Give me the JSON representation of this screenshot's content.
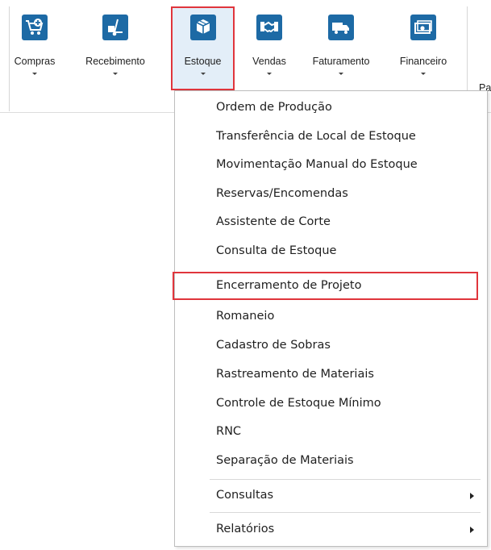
{
  "toolbar": {
    "buttons": [
      {
        "label": "Compras",
        "icon": "cart-plus-icon"
      },
      {
        "label": "Recebimento",
        "icon": "hand-truck-icon"
      },
      {
        "label": "Estoque",
        "icon": "boxes-icon",
        "selected": true
      },
      {
        "label": "Vendas",
        "icon": "handshake-icon"
      },
      {
        "label": "Faturamento",
        "icon": "delivery-truck-icon"
      },
      {
        "label": "Financeiro",
        "icon": "money-icon"
      }
    ],
    "partial_label": "Pa"
  },
  "menu": {
    "items": [
      {
        "label": "Ordem de Produção"
      },
      {
        "label": "Transferência de Local de Estoque"
      },
      {
        "label": "Movimentação Manual do Estoque"
      },
      {
        "label": "Reservas/Encomendas"
      },
      {
        "label": "Assistente de Corte"
      },
      {
        "label": "Consulta de Estoque"
      },
      {
        "label": "Encerramento de Projeto",
        "highlighted": true
      },
      {
        "label": "Romaneio"
      },
      {
        "label": "Cadastro de Sobras"
      },
      {
        "label": "Rastreamento de Materiais"
      },
      {
        "label": "Controle de Estoque Mínimo"
      },
      {
        "label": "RNC"
      },
      {
        "label": "Separação de Materiais"
      },
      {
        "label": "Consultas",
        "submenu": true
      },
      {
        "label": "Relatórios",
        "submenu": true
      }
    ]
  },
  "colors": {
    "icon_bg": "#1d6aa5",
    "highlight_border": "#e0353c",
    "selected_bg": "#e3eef8"
  }
}
